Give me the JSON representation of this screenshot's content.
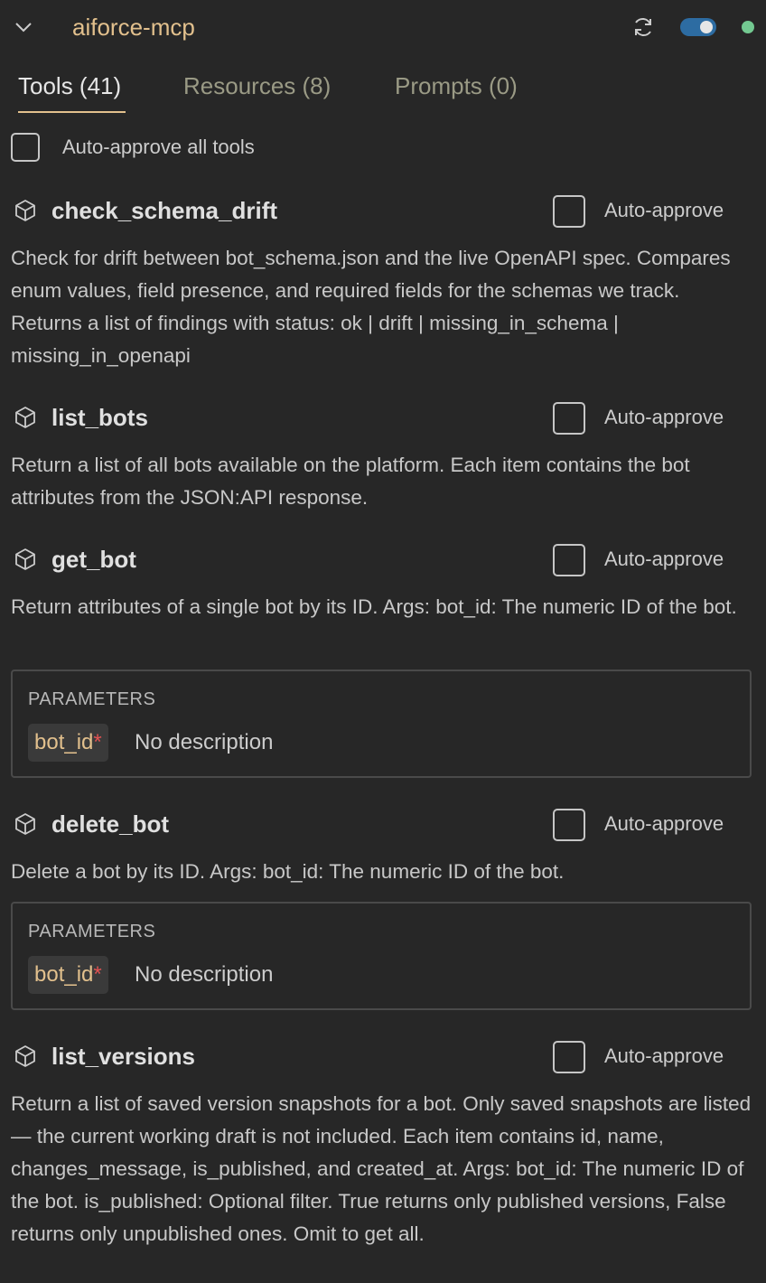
{
  "header": {
    "server_name": "aiforce-mcp",
    "toggle_state": "on",
    "status_color": "#73c991"
  },
  "tabs": [
    {
      "label": "Tools (41)",
      "active": true
    },
    {
      "label": "Resources (8)",
      "active": false
    },
    {
      "label": "Prompts (0)",
      "active": false
    }
  ],
  "auto_approve_all": {
    "label": "Auto-approve all tools",
    "checked": false
  },
  "tools": [
    {
      "name": "check_schema_drift",
      "auto_approve_label": "Auto-approve",
      "auto_approve_checked": false,
      "description": "Check for drift between bot_schema.json and the live OpenAPI spec. Compares enum values, field presence, and required fields for the schemas we track. Returns a list of findings with status: ok | drift | missing_in_schema | missing_in_openapi"
    },
    {
      "name": "list_bots",
      "auto_approve_label": "Auto-approve",
      "auto_approve_checked": false,
      "description": "Return a list of all bots available on the platform. Each item contains the bot attributes from the JSON:API response."
    },
    {
      "name": "get_bot",
      "auto_approve_label": "Auto-approve",
      "auto_approve_checked": false,
      "description": "Return attributes of a single bot by its ID. Args: bot_id: The numeric ID of the bot.",
      "parameters": {
        "title": "PARAMETERS",
        "items": [
          {
            "name": "bot_id",
            "required_marker": "*",
            "description": "No description"
          }
        ]
      }
    },
    {
      "name": "delete_bot",
      "auto_approve_label": "Auto-approve",
      "auto_approve_checked": false,
      "description": "Delete a bot by its ID. Args: bot_id: The numeric ID of the bot.",
      "parameters": {
        "title": "PARAMETERS",
        "items": [
          {
            "name": "bot_id",
            "required_marker": "*",
            "description": "No description"
          }
        ]
      }
    },
    {
      "name": "list_versions",
      "auto_approve_label": "Auto-approve",
      "auto_approve_checked": false,
      "description": "Return a list of saved version snapshots for a bot. Only saved snapshots are listed — the current working draft is not included. Each item contains id, name, changes_message, is_published, and created_at. Args: bot_id: The numeric ID of the bot. is_published: Optional filter. True returns only published versions, False returns only unpublished ones. Omit to get all."
    }
  ],
  "icons": {
    "collapse": "chevron-down-icon",
    "refresh": "refresh-icon",
    "tool": "cube-icon"
  }
}
